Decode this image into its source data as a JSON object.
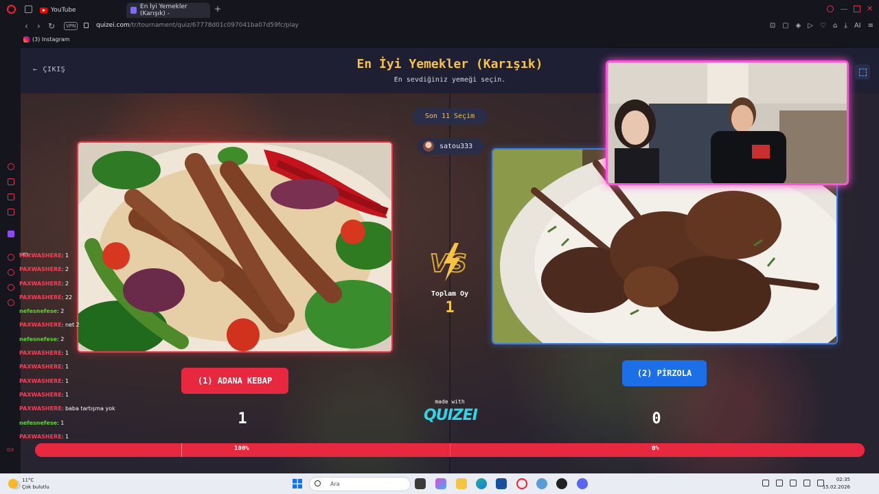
{
  "browser": {
    "tabs": [
      {
        "label": "YouTube"
      },
      {
        "label": "En İyi Yemekler (Karışık) -"
      }
    ],
    "vpn_label": "VPN",
    "url_host": "quizei.com",
    "url_path": "/tr/tournament/quiz/67778d01c097041ba07d59fc/play",
    "bookmark": "(3) Instagram",
    "ai_label": "AI"
  },
  "quiz": {
    "back_label": "ÇIKIŞ",
    "title": "En İyi Yemekler (Karışık)",
    "subtitle": "En sevdiğiniz yemeği seçin.",
    "last_choices": "Son 11 Seçim",
    "username": "satou333",
    "vs_label": "VS",
    "total_label": "Toplam Oy",
    "total_value": "1",
    "left": {
      "button": "(1) ADANA KEBAP",
      "score": "1",
      "percent_label": "100%",
      "percent": 100
    },
    "right": {
      "button": "(2) PİRZOLA",
      "score": "0",
      "percent_label": "0%",
      "percent": 0
    },
    "made_with": "made with",
    "brand": "QUIZEI"
  },
  "chat": {
    "top_fragment": "um",
    "messages": [
      {
        "user": "PAXWASHERE",
        "text": "1",
        "color": "#ff3b55"
      },
      {
        "user": "PAXWASHERE",
        "text": "2",
        "color": "#ff3b55"
      },
      {
        "user": "PAXWASHERE",
        "text": "2",
        "color": "#ff3b55"
      },
      {
        "user": "PAXWASHERE",
        "text": "22",
        "color": "#ff3b55"
      },
      {
        "user": "nefesnefese",
        "text": "2",
        "color": "#5dd62c"
      },
      {
        "user": "PAXWASHERE",
        "text": "net 2",
        "color": "#ff3b55"
      },
      {
        "user": "nefesnefese",
        "text": "2",
        "color": "#5dd62c"
      },
      {
        "user": "PAXWASHERE",
        "text": "1",
        "color": "#ff3b55"
      },
      {
        "user": "PAXWASHERE",
        "text": "1",
        "color": "#ff3b55"
      },
      {
        "user": "PAXWASHERE",
        "text": "1",
        "color": "#ff3b55"
      },
      {
        "user": "PAXWASHERE",
        "text": "1",
        "color": "#ff3b55"
      },
      {
        "user": "PAXWASHERE",
        "text": "baba tartışma yok",
        "color": "#ff3b55"
      },
      {
        "user": "nefesnefese",
        "text": "1",
        "color": "#5dd62c"
      },
      {
        "user": "PAXWASHERE",
        "text": "1",
        "color": "#ff3b55"
      }
    ]
  },
  "taskbar": {
    "temperature": "11°C",
    "weather": "Çok bulutlu",
    "search_placeholder": "Ara",
    "time": "02:35",
    "date": "15.02.2026",
    "sidebar_gx": "GX"
  },
  "colors": {
    "accent_yellow": "#f6c343",
    "left_red": "#e8283e",
    "right_blue": "#1d6fe8",
    "cam_border": "#ff52d6"
  },
  "icons": [
    "opera-icon",
    "tab-manager-icon",
    "back-arrow-icon",
    "forward-arrow-icon",
    "reload-icon",
    "lock-icon",
    "fullscreen-icon",
    "lightning-icon",
    "windows-start-icon",
    "search-icon"
  ]
}
